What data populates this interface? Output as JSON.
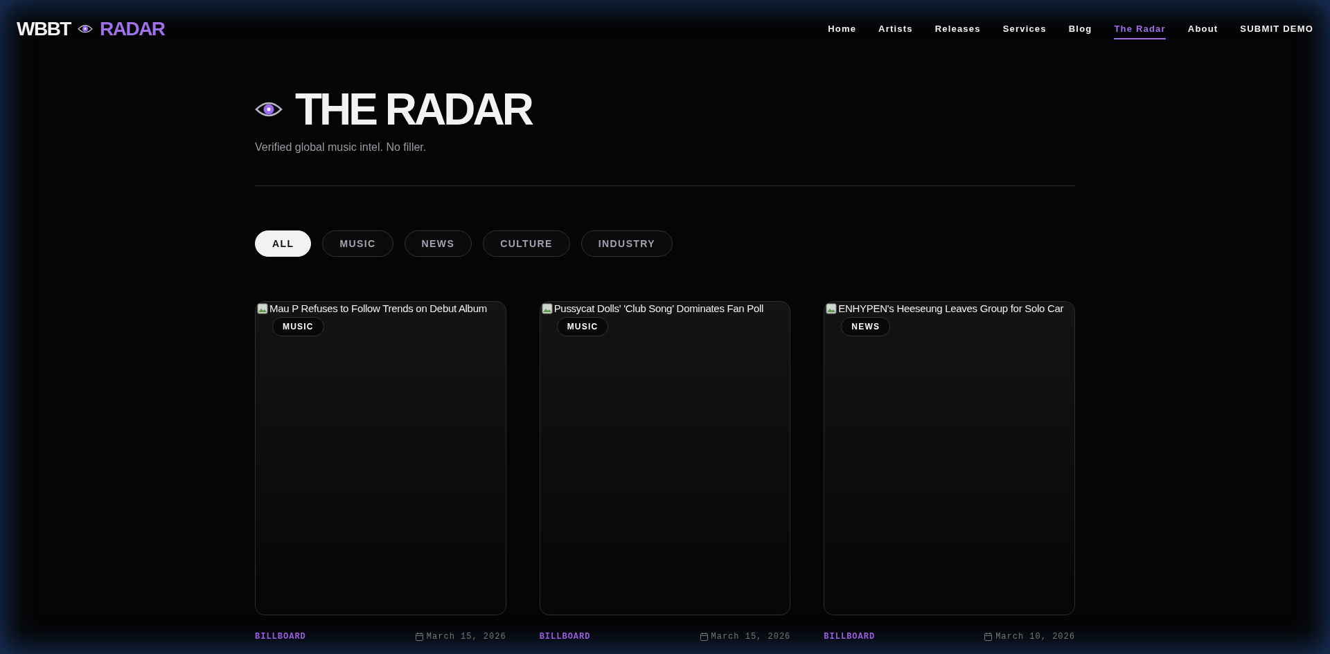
{
  "brand": {
    "left": "WBBT",
    "right": "RADAR"
  },
  "nav": [
    {
      "label": "Home",
      "selected": false
    },
    {
      "label": "Artists",
      "selected": false
    },
    {
      "label": "Releases",
      "selected": false
    },
    {
      "label": "Services",
      "selected": false
    },
    {
      "label": "Blog",
      "selected": false
    },
    {
      "label": "The Radar",
      "selected": true
    },
    {
      "label": "About",
      "selected": false
    },
    {
      "label": "SUBMIT DEMO",
      "selected": false
    }
  ],
  "hero": {
    "title": "THE RADAR",
    "subtitle": "Verified global music intel. No filler."
  },
  "filters": [
    {
      "label": "ALL",
      "selected": true
    },
    {
      "label": "MUSIC",
      "selected": false
    },
    {
      "label": "NEWS",
      "selected": false
    },
    {
      "label": "CULTURE",
      "selected": false
    },
    {
      "label": "INDUSTRY",
      "selected": false
    }
  ],
  "articles": [
    {
      "image_alt": "Mau P Refuses to Follow Trends on Debut Album",
      "category": "MUSIC",
      "source": "BILLBOARD",
      "date": "March 15, 2026"
    },
    {
      "image_alt": "Pussycat Dolls' 'Club Song' Dominates Fan Poll",
      "category": "MUSIC",
      "source": "BILLBOARD",
      "date": "March 15, 2026"
    },
    {
      "image_alt": "ENHYPEN's Heeseung Leaves Group for Solo Car",
      "category": "NEWS",
      "source": "BILLBOARD",
      "date": "March 10, 2026"
    }
  ]
}
